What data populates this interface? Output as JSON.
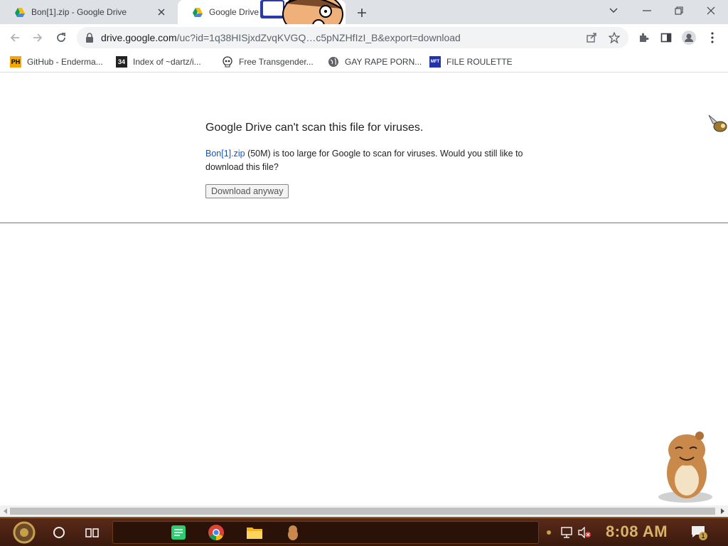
{
  "tabs": [
    {
      "title": "Bon[1].zip - Google Drive",
      "active": false
    },
    {
      "title": "Google Drive -",
      "active": true
    }
  ],
  "toolbar": {
    "url_host": "drive.google.com",
    "url_path": "/uc?id=1q38HISjxdZvqKVGQ…c5pNZHfIzI_B&export=download"
  },
  "bookmarks": [
    {
      "label": "GitHub - Enderma...",
      "icon": "PH"
    },
    {
      "label": "Index of ~dartz/i...",
      "icon": "34"
    },
    {
      "label": "Free Transgender...",
      "icon": "skull-icon"
    },
    {
      "label": "GAY RAPE PORN...",
      "icon": "globe-icon"
    },
    {
      "label": "FILE ROULETTE",
      "icon": "MFT"
    }
  ],
  "page": {
    "title": "Google Drive can't scan this file for viruses.",
    "file_link": "Bon[1].zip",
    "message_rest": " (50M) is too large for Google to scan for viruses. Would you still like to download this file?",
    "button_label": "Download anyway"
  },
  "taskbar": {
    "clock": "8:08 AM",
    "notification_count": "1"
  },
  "colors": {
    "link": "#1155cc",
    "tab_strip": "#dee1e6",
    "clock": "#d9b36a"
  }
}
